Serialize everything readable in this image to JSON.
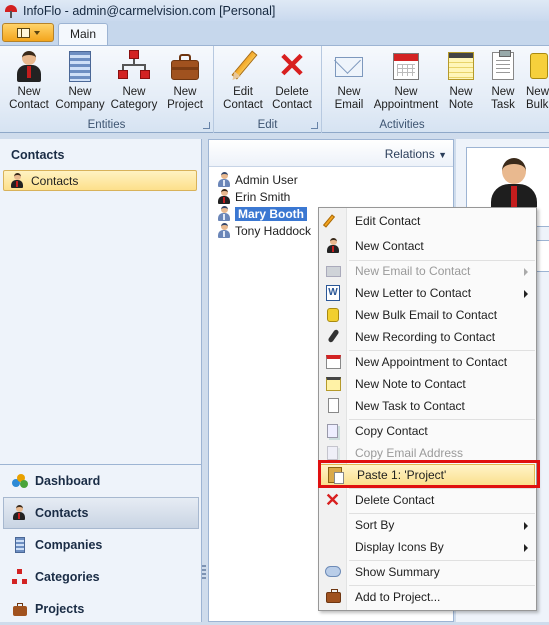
{
  "window": {
    "title": "InfoFlo - admin@carmelvision.com [Personal]"
  },
  "tabs": {
    "main": "Main"
  },
  "ribbon": {
    "groups": {
      "entities": "Entities",
      "edit": "Edit",
      "activities": "Activities"
    },
    "buttons": {
      "new_contact": [
        "New",
        "Contact"
      ],
      "new_company": [
        "New",
        "Company"
      ],
      "new_category": [
        "New",
        "Category"
      ],
      "new_project": [
        "New",
        "Project"
      ],
      "edit_contact": [
        "Edit",
        "Contact"
      ],
      "delete_contact": [
        "Delete",
        "Contact"
      ],
      "new_email": [
        "New",
        "Email"
      ],
      "new_appointment": [
        "New",
        "Appointment"
      ],
      "new_note": [
        "New",
        "Note"
      ],
      "new_task": [
        "New",
        "Task"
      ],
      "new_bulk": [
        "New",
        "Bulk"
      ]
    }
  },
  "left_pane": {
    "header": "Contacts",
    "selected_folder": "Contacts",
    "nav": [
      "Dashboard",
      "Contacts",
      "Companies",
      "Categories",
      "Projects"
    ]
  },
  "list_pane": {
    "relations_label": "Relations",
    "items": [
      "Admin User",
      "Erin Smith",
      "Mary Booth",
      "Tony Haddock"
    ],
    "selected_index": 2
  },
  "context_menu": {
    "items": {
      "edit_contact": "Edit Contact",
      "new_contact": "New Contact",
      "new_email": "New Email to Contact",
      "new_letter": "New Letter to Contact",
      "new_bulk_email": "New Bulk Email to Contact",
      "new_recording": "New Recording to Contact",
      "new_appointment": "New Appointment to Contact",
      "new_note": "New Note to Contact",
      "new_task": "New Task to Contact",
      "copy_contact": "Copy Contact",
      "copy_email": "Copy Email Address",
      "paste": "Paste 1: 'Project'",
      "delete_contact": "Delete Contact",
      "sort_by": "Sort By",
      "display_icons_by": "Display Icons By",
      "show_summary": "Show Summary",
      "add_to_project": "Add to Project..."
    },
    "highlighted": "paste"
  },
  "colors": {
    "accent_highlight": "#e01010",
    "selection": "#3b78d2",
    "ribbon_bg": "#e2ebf6"
  }
}
